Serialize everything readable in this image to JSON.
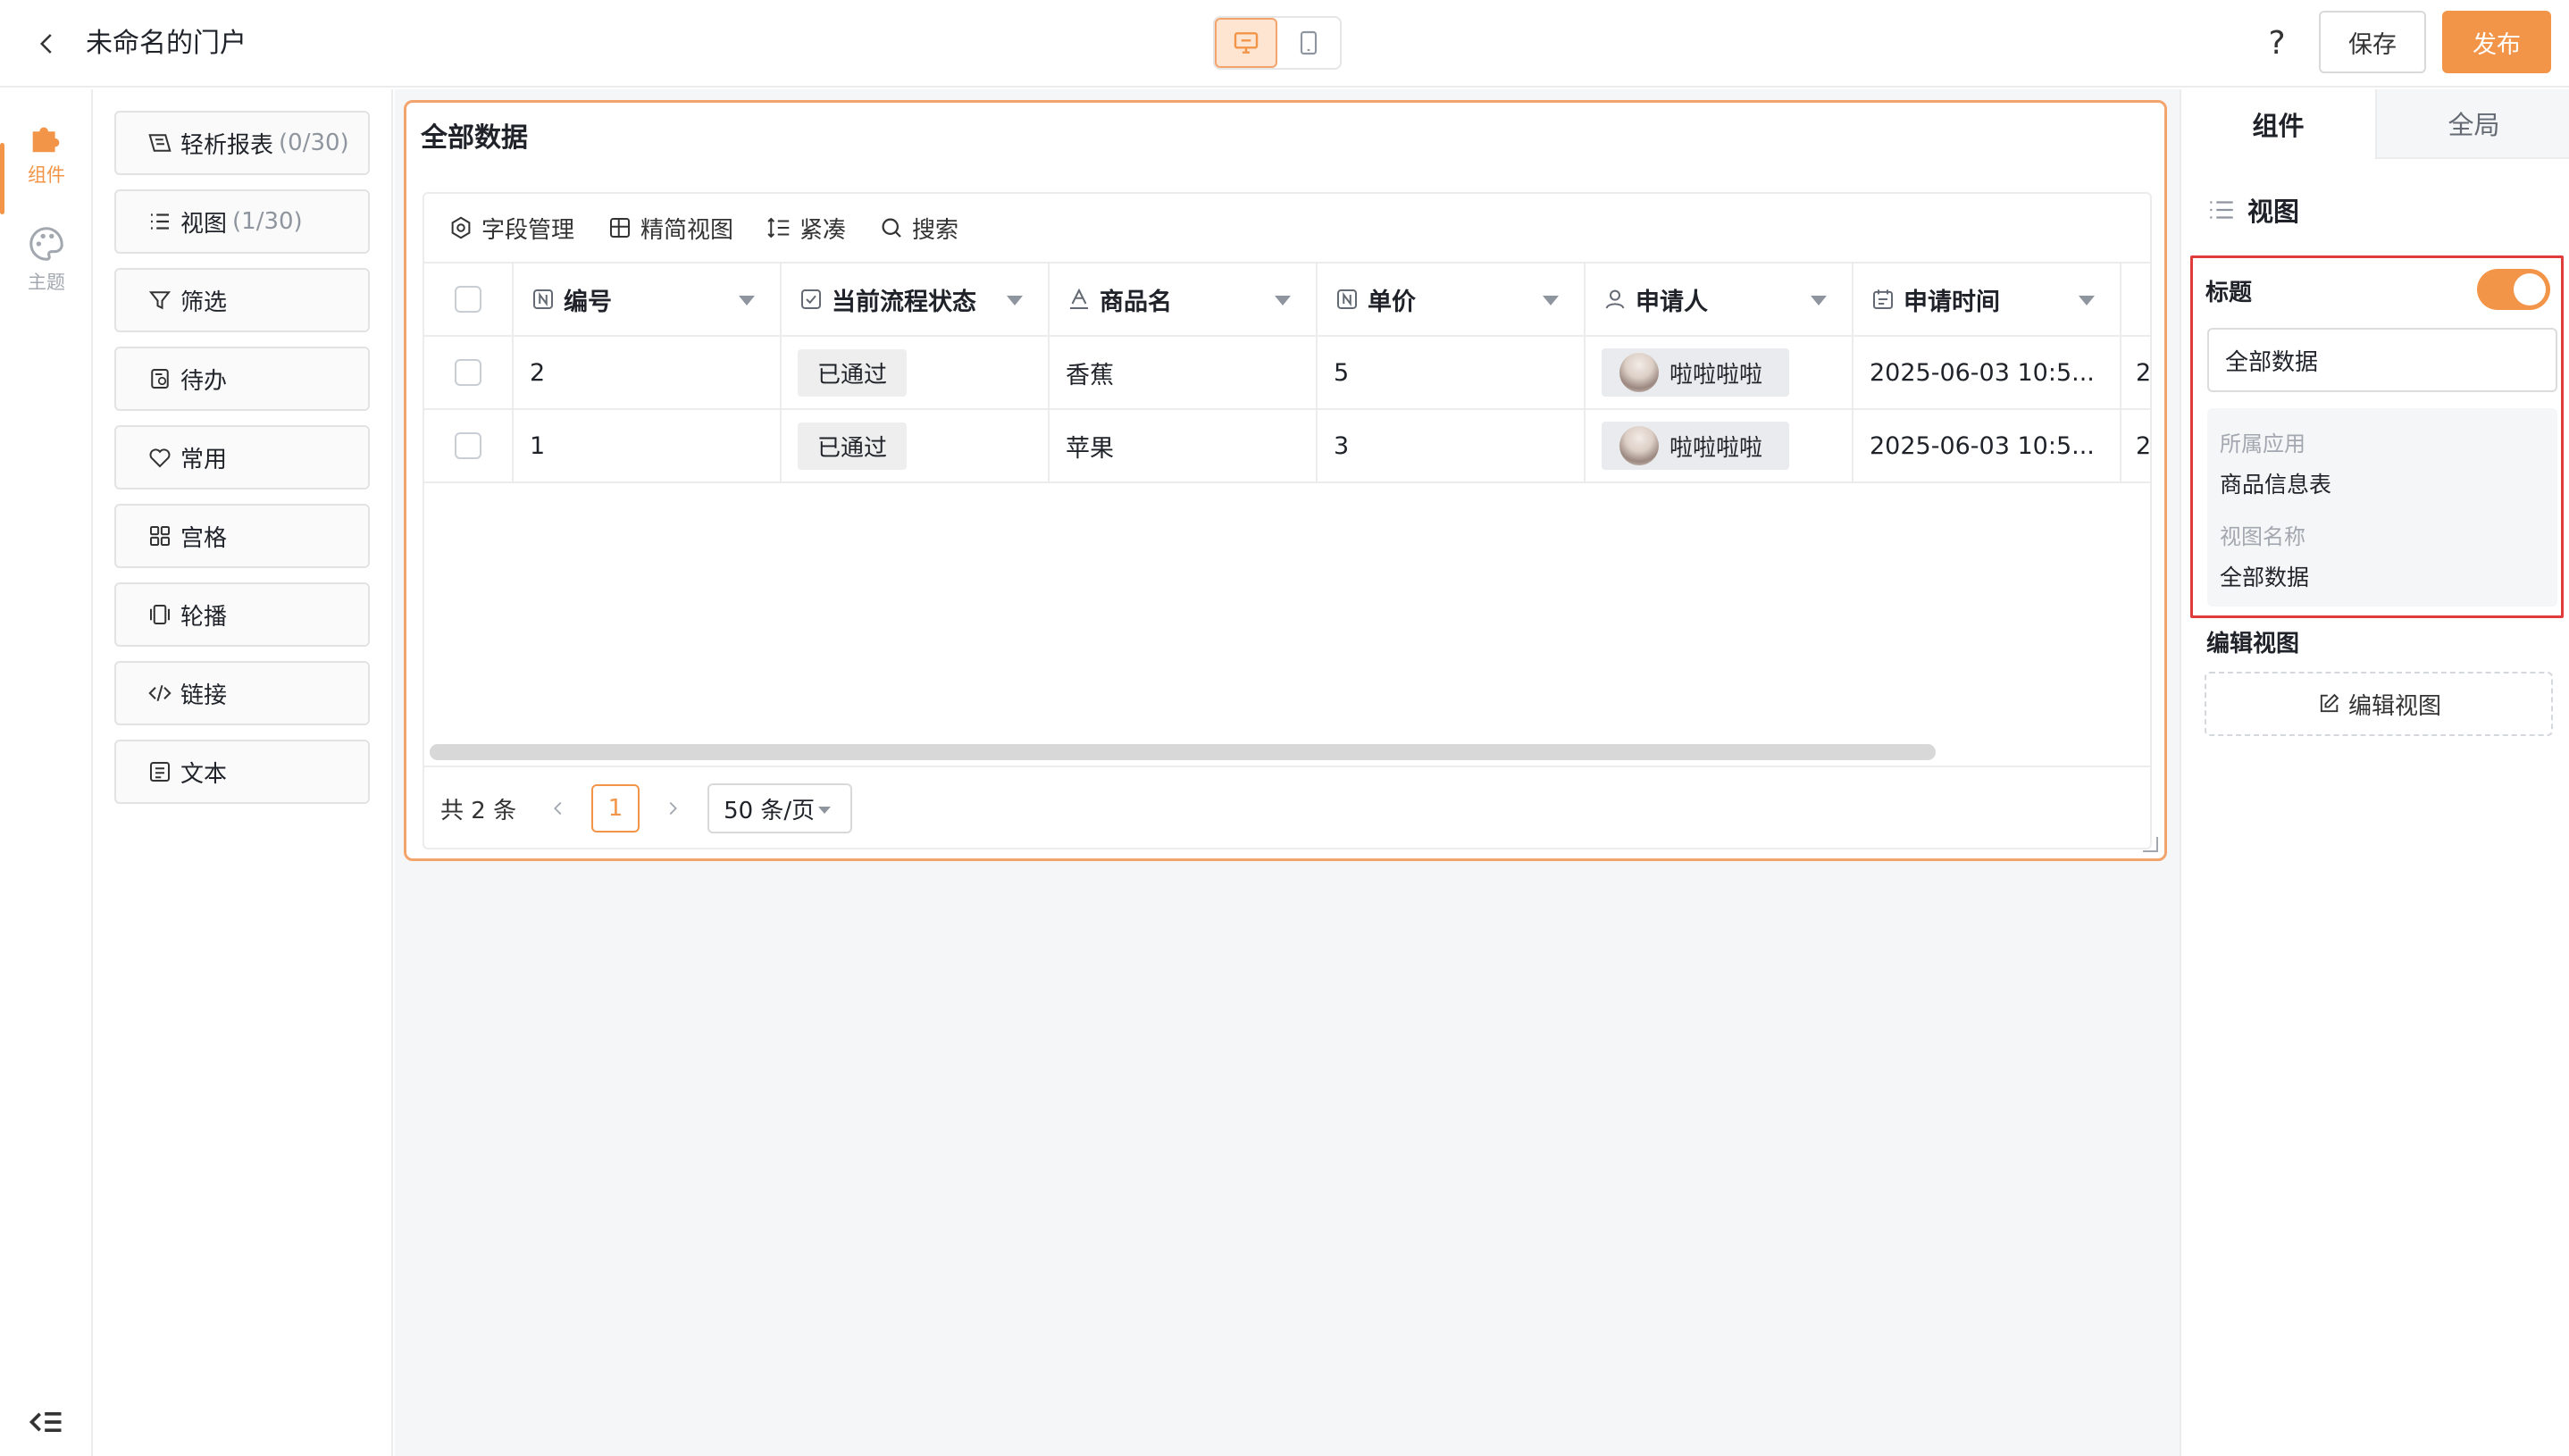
{
  "header": {
    "title": "未命名的门户",
    "help": "?",
    "save_label": "保存",
    "publish_label": "发布"
  },
  "rail": {
    "items": [
      {
        "label": "组件",
        "icon": "puzzle-icon",
        "active": true
      },
      {
        "label": "主题",
        "icon": "palette-icon",
        "active": false
      }
    ]
  },
  "palette": {
    "items": [
      {
        "label": "轻析报表",
        "count": "(0/30)",
        "icon": "report-icon"
      },
      {
        "label": "视图",
        "count": "(1/30)",
        "icon": "list-icon"
      },
      {
        "label": "筛选",
        "count": "",
        "icon": "filter-icon"
      },
      {
        "label": "待办",
        "count": "",
        "icon": "todo-icon"
      },
      {
        "label": "常用",
        "count": "",
        "icon": "heart-icon"
      },
      {
        "label": "宫格",
        "count": "",
        "icon": "grid-icon"
      },
      {
        "label": "轮播",
        "count": "",
        "icon": "carousel-icon"
      },
      {
        "label": "链接",
        "count": "",
        "icon": "code-link-icon"
      },
      {
        "label": "文本",
        "count": "",
        "icon": "text-icon"
      }
    ]
  },
  "view_card": {
    "title": "全部数据",
    "toolbar": {
      "fields": "字段管理",
      "compact_view": "精简视图",
      "dense": "紧凑",
      "search": "搜索"
    },
    "columns": [
      {
        "label": "编号",
        "icon": "number-field-icon"
      },
      {
        "label": "当前流程状态",
        "icon": "checkbox-field-icon"
      },
      {
        "label": "商品名",
        "icon": "text-field-icon"
      },
      {
        "label": "单价",
        "icon": "number-field-icon"
      },
      {
        "label": "申请人",
        "icon": "person-field-icon"
      },
      {
        "label": "申请时间",
        "icon": "date-field-icon"
      }
    ],
    "rows": [
      {
        "id": "2",
        "status": "已通过",
        "name": "香蕉",
        "price": "5",
        "applicant": "啦啦啦啦",
        "time": "2025-06-03 10:5...",
        "extra": "2"
      },
      {
        "id": "1",
        "status": "已通过",
        "name": "苹果",
        "price": "3",
        "applicant": "啦啦啦啦",
        "time": "2025-06-03 10:5...",
        "extra": "2"
      }
    ],
    "pager": {
      "total": "共 2 条",
      "current": "1",
      "page_size": "50 条/页"
    }
  },
  "right_panel": {
    "tabs": [
      "组件",
      "全局"
    ],
    "section_title": "视图",
    "title_label": "标题",
    "title_value": "全部数据",
    "app_label": "所属应用",
    "app_value": "商品信息表",
    "view_name_label": "视图名称",
    "view_name_value": "全部数据",
    "edit_title": "编辑视图",
    "edit_button": "编辑视图"
  },
  "colors": {
    "accent": "#f29548",
    "accent_light": "#fde5d2",
    "highlight_red": "#e03c3c"
  }
}
